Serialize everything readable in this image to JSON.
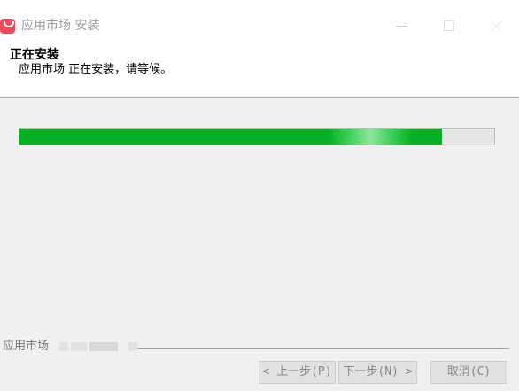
{
  "window": {
    "title": "应用市场 安装",
    "accent_color": "#f04a5a"
  },
  "header": {
    "title": "正在安装",
    "subtitle": "应用市场 正在安装，请等候。"
  },
  "progress": {
    "fraction": 0.89,
    "fill_color": "#06b025"
  },
  "footer": {
    "brand_label": "应用市场"
  },
  "buttons": {
    "back_label": "< 上一步(P)",
    "next_label": "下一步(N) >",
    "cancel_label": "取消(C)"
  }
}
